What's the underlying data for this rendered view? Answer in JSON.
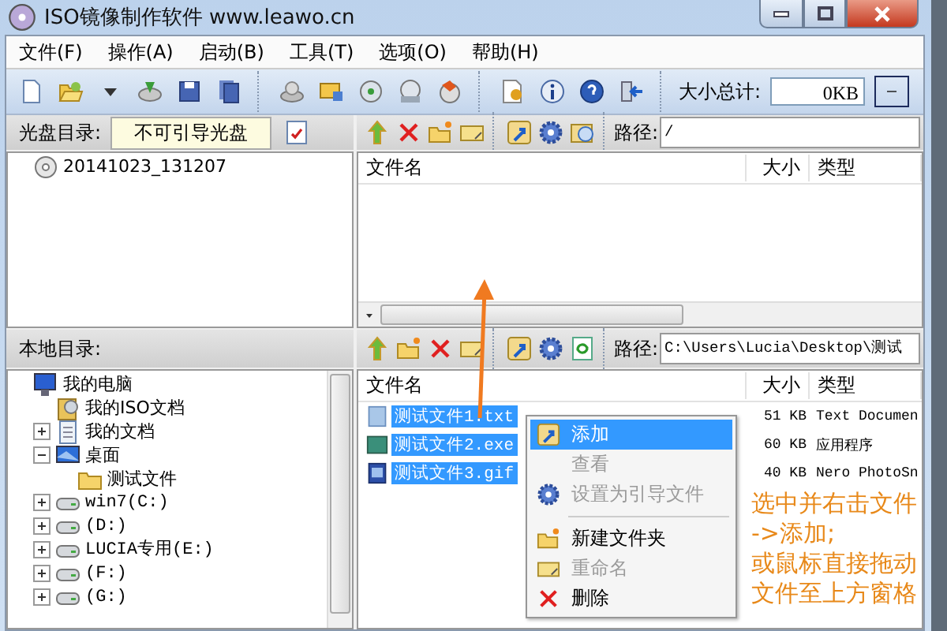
{
  "window": {
    "title": "ISO镜像制作软件 www.leawo.cn"
  },
  "menu": [
    "文件(F)",
    "操作(A)",
    "启动(B)",
    "工具(T)",
    "选项(O)",
    "帮助(H)"
  ],
  "toolbar": {
    "total_label": "大小总计:",
    "total_value": "0KB"
  },
  "disc_pane": {
    "label": "光盘目录:",
    "boot_mode": "不可引导光盘",
    "path_label": "路径:",
    "path": "/",
    "columns": [
      "文件名",
      "大小",
      "类型"
    ],
    "tree": [
      {
        "label": "20141023_131207",
        "kind": "disc"
      }
    ]
  },
  "local_pane": {
    "label": "本地目录:",
    "path_label": "路径:",
    "path": "C:\\Users\\Lucia\\Desktop\\测试",
    "columns": [
      "文件名",
      "大小",
      "类型"
    ],
    "tree": [
      {
        "label": "我的电脑",
        "kind": "computer",
        "children": [
          {
            "label": "我的ISO文档",
            "kind": "isodocs"
          },
          {
            "label": "我的文档",
            "kind": "documents",
            "expanded": false
          },
          {
            "label": "桌面",
            "kind": "desktop",
            "expanded": true,
            "children": [
              {
                "label": "测试文件",
                "kind": "folder"
              }
            ]
          },
          {
            "label": "win7(C:)",
            "kind": "drive",
            "expanded": false
          },
          {
            "label": "(D:)",
            "kind": "drive",
            "expanded": false
          },
          {
            "label": "LUCIA专用(E:)",
            "kind": "drive",
            "expanded": false
          },
          {
            "label": "(F:)",
            "kind": "drive",
            "expanded": false
          },
          {
            "label": "(G:)",
            "kind": "drive",
            "expanded": false
          }
        ]
      }
    ],
    "files": [
      {
        "name": "测试文件1.txt",
        "size": "51 KB",
        "type": "Text Documen",
        "kind": "text",
        "selected": true
      },
      {
        "name": "测试文件2.exe",
        "size": "60 KB",
        "type": "应用程序",
        "kind": "exe",
        "selected": true
      },
      {
        "name": "测试文件3.gif",
        "size": "40 KB",
        "type": "Nero PhotoSn",
        "kind": "image",
        "selected": true
      }
    ]
  },
  "context_menu": [
    {
      "kind": "item",
      "label": "添加",
      "selected": true,
      "disabled": false
    },
    {
      "kind": "item",
      "label": "查看",
      "selected": false,
      "disabled": true
    },
    {
      "kind": "item",
      "label": "设置为引导文件",
      "selected": false,
      "disabled": true
    },
    {
      "kind": "separator"
    },
    {
      "kind": "item",
      "label": "新建文件夹",
      "selected": false,
      "disabled": false
    },
    {
      "kind": "item",
      "label": "重命名",
      "selected": false,
      "disabled": true
    },
    {
      "kind": "item",
      "label": "删除",
      "selected": false,
      "disabled": false
    }
  ],
  "annotation": {
    "lines": [
      "选中并右击文件",
      "->添加;",
      "或鼠标直接拖动",
      "文件至上方窗格"
    ]
  }
}
